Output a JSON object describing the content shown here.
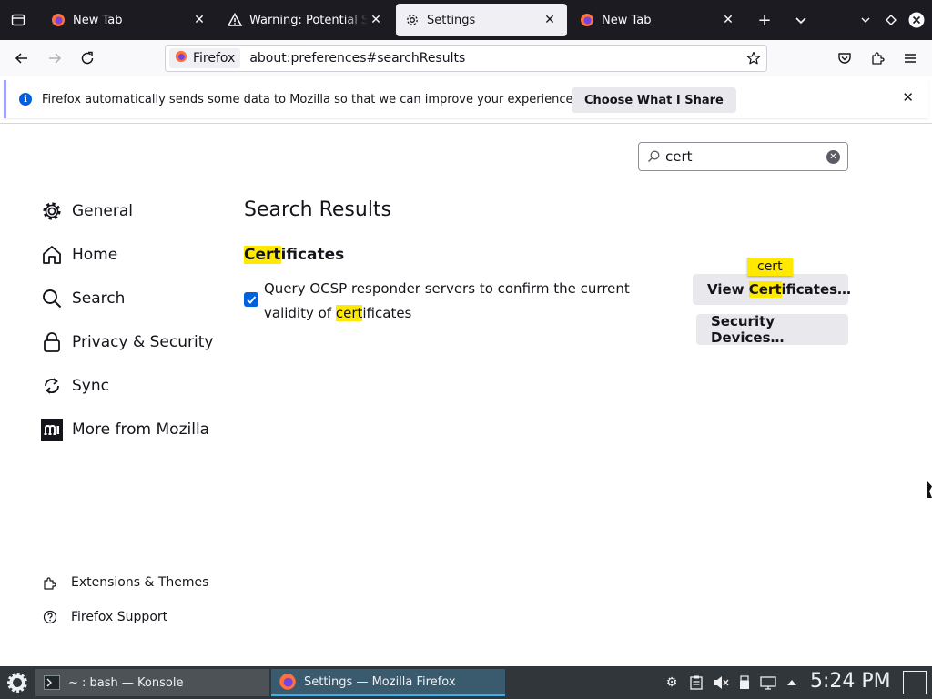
{
  "browser": {
    "tabs": [
      {
        "title": "New Tab",
        "favicon": "firefox-icon",
        "active": false
      },
      {
        "title": "Warning: Potential Security Risk Ahead",
        "favicon": "warning-icon",
        "active": false
      },
      {
        "title": "Settings",
        "favicon": "gear-icon",
        "active": true
      },
      {
        "title": "New Tab",
        "favicon": "firefox-icon",
        "active": false
      }
    ],
    "identity_label": "Firefox",
    "url": "about:preferences#searchResults"
  },
  "notification": {
    "message": "Firefox automatically sends some data to Mozilla so that we can improve your experience.",
    "button": "Choose What I Share"
  },
  "preferences": {
    "search_value": "cert",
    "categories": [
      {
        "label": "General",
        "icon": "gear-icon"
      },
      {
        "label": "Home",
        "icon": "home-icon"
      },
      {
        "label": "Search",
        "icon": "search-icon"
      },
      {
        "label": "Privacy & Security",
        "icon": "lock-icon"
      },
      {
        "label": "Sync",
        "icon": "sync-icon"
      },
      {
        "label": "More from Mozilla",
        "icon": "mozilla-icon"
      }
    ],
    "footer_links": [
      {
        "label": "Extensions & Themes",
        "icon": "puzzle-icon"
      },
      {
        "label": "Firefox Support",
        "icon": "help-icon"
      }
    ],
    "results_heading": "Search Results",
    "section": {
      "title_match": "Cert",
      "title_rest": "ificates",
      "ocsp_before": "Query OCSP responder servers to confirm the current validity of ",
      "ocsp_match": "cert",
      "ocsp_after": "ificates",
      "ocsp_checked": true,
      "view_btn_before": "View ",
      "view_btn_match": "Cert",
      "view_btn_after": "ificates…",
      "tooltip": "cert",
      "devices_btn": "Security Devices…"
    }
  },
  "taskbar": {
    "tasks": [
      {
        "label": "~ : bash — Konsole",
        "icon": "terminal-icon"
      },
      {
        "label": "Settings — Mozilla Firefox",
        "icon": "firefox-icon"
      }
    ],
    "clock": "5:24 PM"
  },
  "colors": {
    "accent": "#0061e0",
    "highlight": "#ffe900",
    "taskbar": "#31363b"
  }
}
